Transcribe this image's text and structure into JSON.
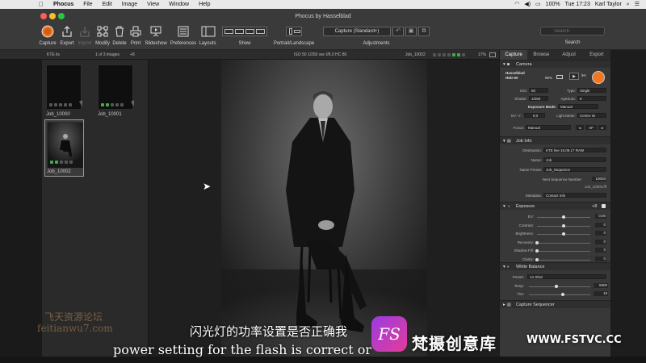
{
  "menubar": {
    "app_name": "Phocus",
    "items": [
      "File",
      "Edit",
      "Image",
      "View",
      "Window",
      "Help"
    ],
    "battery": "100%",
    "clock": "Tue 17:23",
    "user": "Karl Taylor"
  },
  "window": {
    "title": "Phocus by Hasselblad"
  },
  "toolbar": {
    "capture": "Capture",
    "export": "Export",
    "import": "Import",
    "modify": "Modify",
    "delete": "Delete",
    "print": "Print",
    "slideshow": "Slideshow",
    "preferences": "Preferences",
    "layouts": "Layouts",
    "show": "Show",
    "orientation": "Portrait/Landscape",
    "adjustments": "Adjustments",
    "adjustment_preset": "Capture (Standard+)",
    "search_placeholder": "Search",
    "search": "Search"
  },
  "subbar": {
    "folder": "KTE lis",
    "count": "1 of 3 images",
    "plus": "+8",
    "exposure_info": "ISO 50   1/250 sec   f/8.0   HC 80",
    "current": "Job_10002",
    "zoom": "17%"
  },
  "thumbnails": [
    {
      "label": "Job_10000"
    },
    {
      "label": "Job_10001"
    },
    {
      "label": "Job_10002"
    }
  ],
  "panel": {
    "tabs": [
      "Capture",
      "Browse",
      "Adjust",
      "Export"
    ],
    "camera": {
      "title": "Camera",
      "model": "Hasselblad H5D-50",
      "battery": "95%",
      "iso_label": "ISO:",
      "iso": "50",
      "type_label": "Type:",
      "type": "Single",
      "shutter_label": "Shutter:",
      "shutter": "1/250",
      "aperture_label": "Aperture:",
      "aperture": "8",
      "mode_label": "Exposure Mode:",
      "mode": "Manual",
      "ev_label": "EV +/-:",
      "ev": "0,0",
      "meter_label": "Light Meter:",
      "meter": "Centre W",
      "focus_label": "Focus:",
      "focus": "Manual",
      "af": "AF"
    },
    "jobinfo": {
      "title": "Job Info",
      "destination_label": "Destination:",
      "destination": "KTE live 15.09.17 RAW",
      "name_label": "Name:",
      "name": "Job",
      "preset_label": "Name Preset:",
      "preset": "Job_Sequence",
      "next_label": "Next Sequence Number:",
      "next": "10003",
      "next_file": "Job_10003.fff",
      "metadata_label": "Metadata:",
      "metadata": "Contact Info"
    },
    "exposure": {
      "title": "Exposure",
      "badge": "+8",
      "rows": [
        {
          "label": "EV:",
          "value": "0,00",
          "pos": 0.5
        },
        {
          "label": "Contrast:",
          "value": "0",
          "pos": 0.5
        },
        {
          "label": "Brightness:",
          "value": "0",
          "pos": 0.5
        },
        {
          "label": "Recovery:",
          "value": "0",
          "pos": 0.0
        },
        {
          "label": "Shadow Fill:",
          "value": "0",
          "pos": 0.0
        },
        {
          "label": "Clarity:",
          "value": "0",
          "pos": 0.0
        }
      ]
    },
    "whitebalance": {
      "title": "White Balance",
      "preset_label": "Preset:",
      "preset": "As Shot",
      "temp_label": "Temp:",
      "temp": "5900",
      "temp_pos": 0.45,
      "tint_label": "Tint:",
      "tint": "19",
      "tint_pos": 0.55
    },
    "sequencer": {
      "title": "Capture Sequencer"
    }
  },
  "overlay": {
    "subtitle_cn": "闪光灯的功率设置是否正确我",
    "subtitle_en": "power setting for the flash is correct or",
    "watermark_cn": "飞天资源论坛",
    "watermark_url": "feitianwu7.com",
    "badge": "FS",
    "brand_cn": "梵摄创意库",
    "brand_url": "WWW.FSTVC.CC"
  }
}
